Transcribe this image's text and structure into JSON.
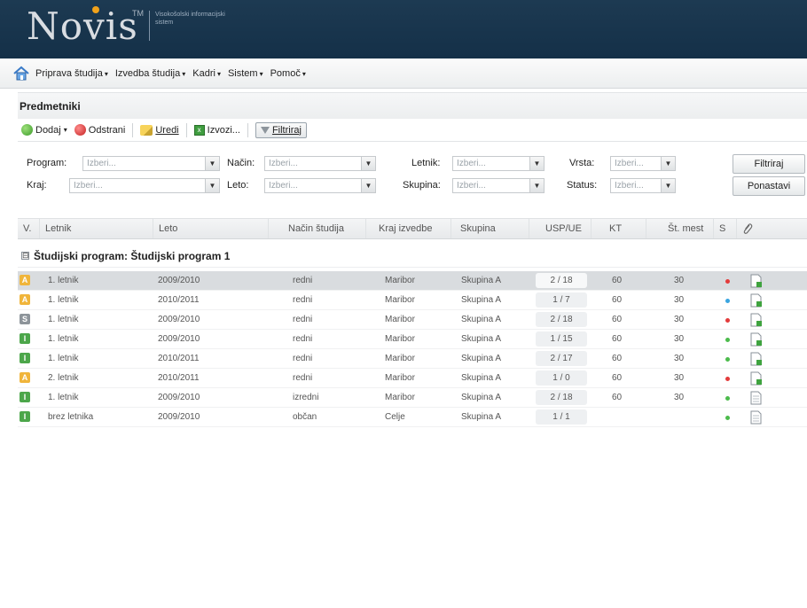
{
  "header": {
    "logo_text": "Novis",
    "trademark": "TM",
    "tagline": "Visokošolski informacijski sistem"
  },
  "menu": [
    {
      "label": "Priprava študija",
      "caret": "▾"
    },
    {
      "label": "Izvedba študija",
      "caret": "▾"
    },
    {
      "label": "Kadri",
      "caret": "▾"
    },
    {
      "label": "Sistem",
      "caret": "▾"
    },
    {
      "label": "Pomoč",
      "caret": "▾"
    }
  ],
  "panel": {
    "title": "Predmetniki"
  },
  "toolbar": {
    "add_label": "Dodaj",
    "delete_label": "Odstrani",
    "edit_label": "Uredi",
    "export_label": "Izvozi...",
    "filter_label": "Filtriraj"
  },
  "filters": {
    "program_label": "Program:",
    "kraj_label": "Kraj:",
    "nacin_label": "Način:",
    "leto_label": "Leto:",
    "letnik_label": "Letnik:",
    "skupina_label": "Skupina:",
    "vrsta_label": "Vrsta:",
    "status_label": "Status:",
    "placeholder": "Izberi...",
    "filter_button": "Filtriraj",
    "reset_button": "Ponastavi"
  },
  "columns": {
    "v": "V.",
    "letnik": "Letnik",
    "leto": "Leto",
    "nacin": "Način študija",
    "kraj": "Kraj izvedbe",
    "skupina": "Skupina",
    "usp": "USP/UE",
    "kt": "KT",
    "mest": "Št. mest",
    "s": "S"
  },
  "group": {
    "toggle": "⊟",
    "label": "Študijski program: Študijski program 1"
  },
  "rows": [
    {
      "v": "A",
      "v_color": "#f0b53b",
      "letnik": "1. letnik",
      "leto": "2009/2010",
      "nacin": "redni",
      "kraj": "Maribor",
      "skupina": "Skupina A",
      "usp": "2 / 18",
      "kt": "60",
      "mest": "30",
      "s_color": "#e33b3b",
      "doc": "green"
    },
    {
      "v": "A",
      "v_color": "#f0b53b",
      "letnik": "1. letnik",
      "leto": "2010/2011",
      "nacin": "redni",
      "kraj": "Maribor",
      "skupina": "Skupina A",
      "usp": "1 / 7",
      "kt": "60",
      "mest": "30",
      "s_color": "#3aa5e0",
      "doc": "green"
    },
    {
      "v": "S",
      "v_color": "#8d949a",
      "letnik": "1. letnik",
      "leto": "2009/2010",
      "nacin": "redni",
      "kraj": "Maribor",
      "skupina": "Skupina A",
      "usp": "2 / 18",
      "kt": "60",
      "mest": "30",
      "s_color": "#e33b3b",
      "doc": "green"
    },
    {
      "v": "I",
      "v_color": "#4ca64a",
      "letnik": "1. letnik",
      "leto": "2009/2010",
      "nacin": "redni",
      "kraj": "Maribor",
      "skupina": "Skupina A",
      "usp": "1 / 15",
      "kt": "60",
      "mest": "30",
      "s_color": "#4cbb4c",
      "doc": "green"
    },
    {
      "v": "I",
      "v_color": "#4ca64a",
      "letnik": "1. letnik",
      "leto": "2010/2011",
      "nacin": "redni",
      "kraj": "Maribor",
      "skupina": "Skupina A",
      "usp": "2 / 17",
      "kt": "60",
      "mest": "30",
      "s_color": "#4cbb4c",
      "doc": "green"
    },
    {
      "v": "A",
      "v_color": "#f0b53b",
      "letnik": "2. letnik",
      "leto": "2010/2011",
      "nacin": "redni",
      "kraj": "Maribor",
      "skupina": "Skupina A",
      "usp": "1 / 0",
      "kt": "60",
      "mest": "30",
      "s_color": "#e33b3b",
      "doc": "green"
    },
    {
      "v": "I",
      "v_color": "#4ca64a",
      "letnik": "1. letnik",
      "leto": "2009/2010",
      "nacin": "izredni",
      "kraj": "Maribor",
      "skupina": "Skupina A",
      "usp": "2 / 18",
      "kt": "60",
      "mest": "30",
      "s_color": "#4cbb4c",
      "doc": "plain"
    },
    {
      "v": "I",
      "v_color": "#4ca64a",
      "letnik": "brez letnika",
      "leto": "2009/2010",
      "nacin": "občan",
      "kraj": "Celje",
      "skupina": "Skupina A",
      "usp": "1 / 1",
      "kt": "",
      "mest": "",
      "s_color": "#4cbb4c",
      "doc": "plain"
    }
  ],
  "selected_row_index": 0
}
